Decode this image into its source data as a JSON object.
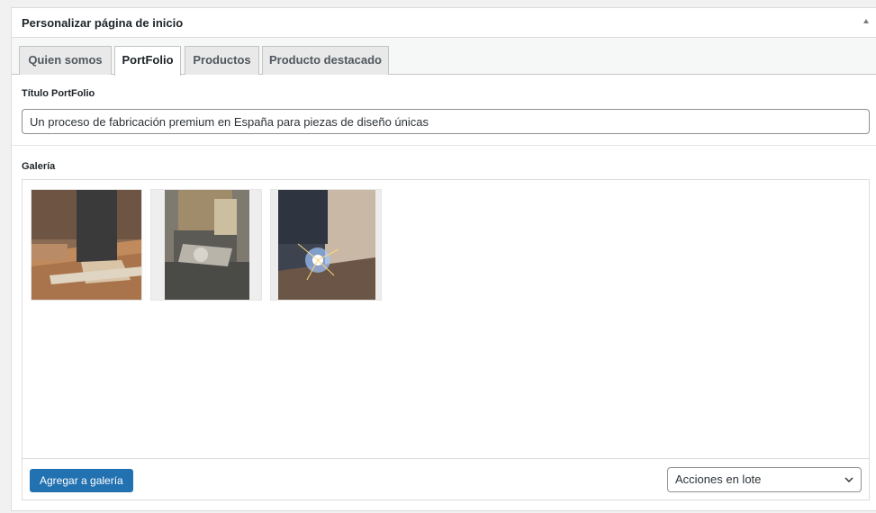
{
  "metabox": {
    "title": "Personalizar página de inicio"
  },
  "tabs": [
    {
      "label": "Quien somos",
      "active": false
    },
    {
      "label": "PortFolio",
      "active": true
    },
    {
      "label": "Productos",
      "active": false
    },
    {
      "label": "Producto destacado",
      "active": false
    }
  ],
  "portfolio": {
    "title_label": "Título PortFolio",
    "title_value": "Un proceso de fabricación premium en España para piezas de diseño únicas",
    "gallery_label": "Galería"
  },
  "gallery": {
    "images": [
      {
        "icon": "photo-woodworking"
      },
      {
        "icon": "photo-sawing"
      },
      {
        "icon": "photo-welding"
      }
    ],
    "add_button_label": "Agregar a galería",
    "bulk_actions_label": "Acciones en lote"
  },
  "colors": {
    "primary": "#2271b1",
    "border": "#dcdcde",
    "background": "#f1f1f1"
  }
}
